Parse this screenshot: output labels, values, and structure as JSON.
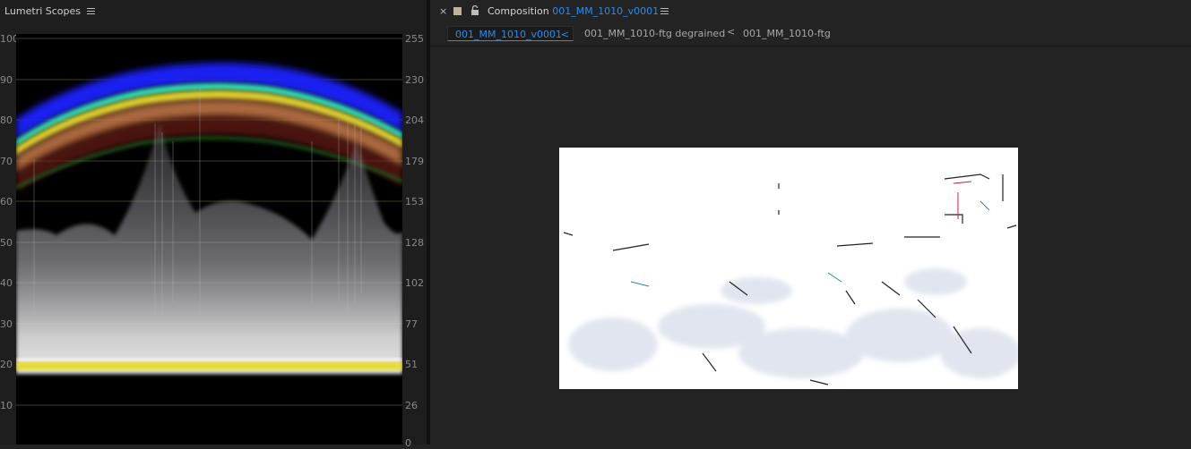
{
  "scopes": {
    "title": "Lumetri Scopes",
    "left_ticks": [
      "100",
      "90",
      "80",
      "70",
      "60",
      "50",
      "40",
      "30",
      "20",
      "10"
    ],
    "right_ticks": [
      "255",
      "230",
      "204",
      "179",
      "153",
      "128",
      "102",
      "77",
      "51",
      "26",
      "0"
    ]
  },
  "composition": {
    "label": "Composition",
    "name": "001_MM_1010_v0001",
    "close_glyph": "×",
    "tabs": [
      {
        "label": "001_MM_1010_v0001",
        "active": true
      },
      {
        "label": "001_MM_1010-ftg degrained",
        "active": false
      },
      {
        "label": "001_MM_1010-ftg",
        "active": false
      }
    ],
    "breadcrumb_sep": "<"
  },
  "colors": {
    "accent": "#2d8ceb",
    "panel_bg": "#1e1e1e",
    "scope_bg": "#000000"
  }
}
